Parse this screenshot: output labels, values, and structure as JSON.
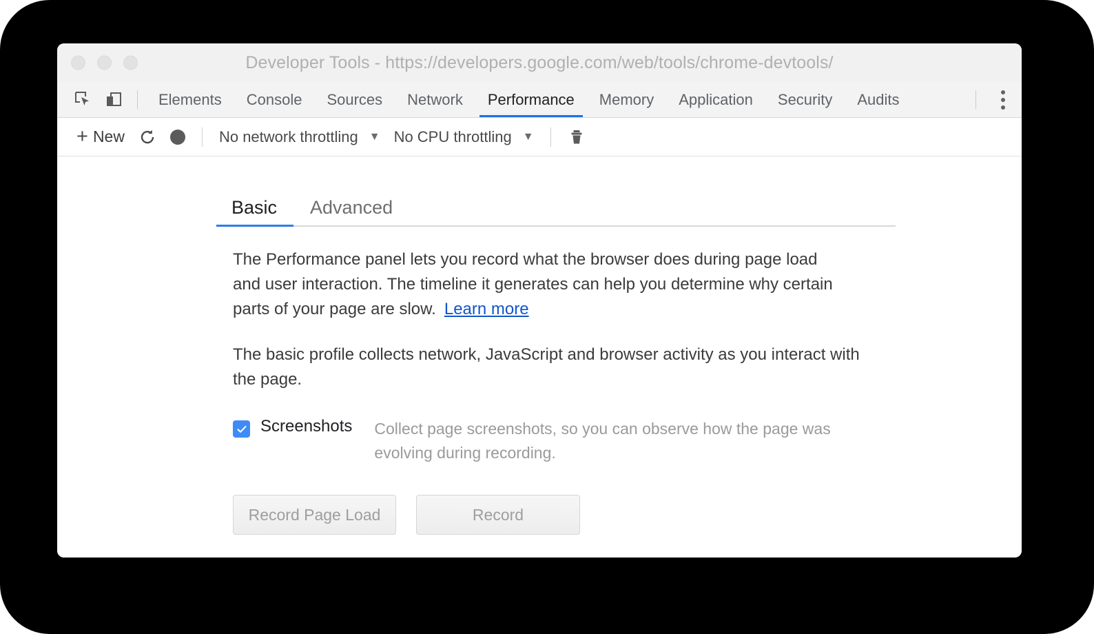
{
  "window": {
    "title": "Developer Tools - https://developers.google.com/web/tools/chrome-devtools/",
    "traffic_lights": [
      "close",
      "minimize",
      "maximize"
    ]
  },
  "tabbar": {
    "icons": [
      {
        "name": "inspect-element-icon"
      },
      {
        "name": "device-toolbar-icon"
      }
    ],
    "tabs": [
      {
        "label": "Elements",
        "active": false
      },
      {
        "label": "Console",
        "active": false
      },
      {
        "label": "Sources",
        "active": false
      },
      {
        "label": "Network",
        "active": false
      },
      {
        "label": "Performance",
        "active": true
      },
      {
        "label": "Memory",
        "active": false
      },
      {
        "label": "Application",
        "active": false
      },
      {
        "label": "Security",
        "active": false
      },
      {
        "label": "Audits",
        "active": false
      }
    ],
    "menu_icon": "more-vertical-icon",
    "active_underline_color": "#1a73e8"
  },
  "toolbar": {
    "new_label": "New",
    "plus_glyph": "+",
    "reload_icon": "refresh-icon",
    "record_icon": "record-dot-icon",
    "network_throttling": "No network throttling",
    "cpu_throttling": "No CPU throttling",
    "caret_glyph": "▼",
    "clear_icon": "trash-icon"
  },
  "panel": {
    "subtabs": [
      {
        "label": "Basic",
        "active": true
      },
      {
        "label": "Advanced",
        "active": false
      }
    ],
    "paragraph_1": "The Performance panel lets you record what the browser does during page load and user interaction. The timeline it generates can help you determine why certain parts of your page are slow.",
    "learn_more": "Learn more",
    "paragraph_2": "The basic profile collects network, JavaScript and browser activity as you interact with the page.",
    "screenshots": {
      "checked": true,
      "check_glyph": "✓",
      "label": "Screenshots",
      "description": "Collect page screenshots, so you can observe how the page was evolving during recording."
    },
    "buttons": [
      {
        "label": "Record Page Load"
      },
      {
        "label": "Record"
      }
    ]
  },
  "colors": {
    "accent_blue": "#1a73e8",
    "subtab_blue": "#2b7de9",
    "checkbox_blue": "#3e8bf7",
    "link_blue": "#1155cc",
    "titlebar_bg": "#f1f1f1",
    "tabbar_bg": "#f3f3f3",
    "backdrop": "#000000"
  }
}
